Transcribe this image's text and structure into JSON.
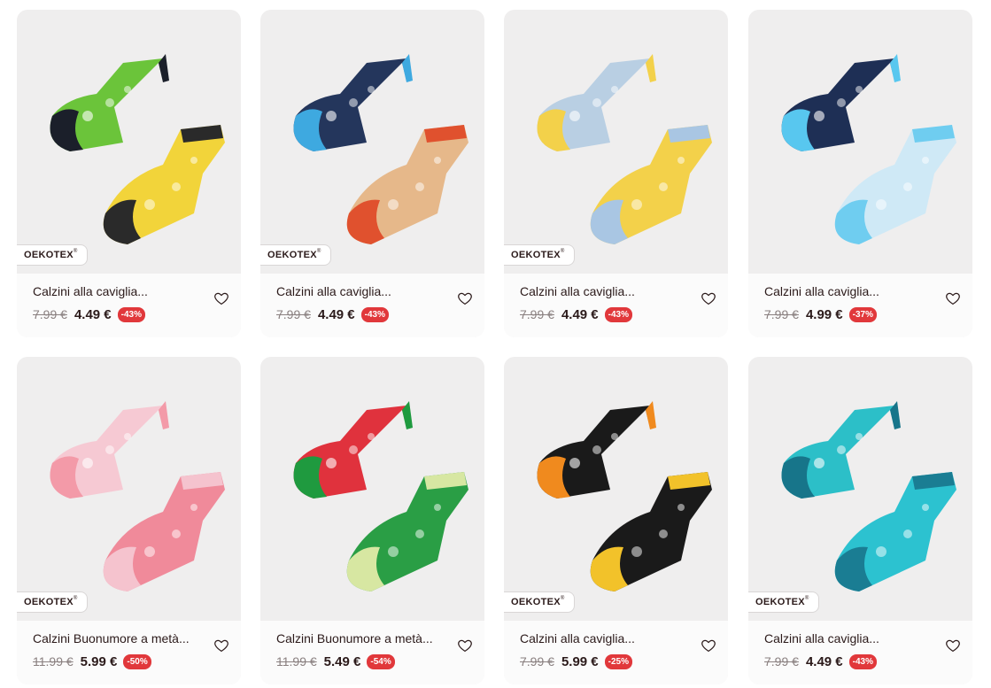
{
  "badge_label": "OEKOTEX",
  "badge_mark": "®",
  "products": [
    {
      "title": "Calzini alla caviglia...",
      "old_price": "7.99 €",
      "price": "4.49 €",
      "discount": "-43%",
      "badge": true,
      "icon": "bee-socks-image",
      "colors": [
        "#6bc43a",
        "#1b1f2a",
        "#f2d43a",
        "#2a2a2a"
      ]
    },
    {
      "title": "Calzini alla caviglia...",
      "old_price": "7.99 €",
      "price": "4.49 €",
      "discount": "-43%",
      "badge": true,
      "icon": "sailboat-socks-image",
      "colors": [
        "#24365c",
        "#3ea9e0",
        "#e6b88a",
        "#e0512e"
      ]
    },
    {
      "title": "Calzini alla caviglia...",
      "old_price": "7.99 €",
      "price": "4.49 €",
      "discount": "-43%",
      "badge": true,
      "icon": "lotus-socks-image",
      "colors": [
        "#b9cfe3",
        "#f3d14a",
        "#f3d14a",
        "#a9c6e3"
      ]
    },
    {
      "title": "Calzini alla caviglia...",
      "old_price": "7.99 €",
      "price": "4.99 €",
      "discount": "-37%",
      "badge": false,
      "icon": "ocean-socks-image",
      "colors": [
        "#1e2f55",
        "#58c7ef",
        "#cfe9f6",
        "#6fcdf0"
      ]
    },
    {
      "title": "Calzini Buonumore a metà...",
      "old_price": "11.99 €",
      "price": "5.99 €",
      "discount": "-50%",
      "badge": true,
      "icon": "strawberry-socks-image",
      "colors": [
        "#f6c9d3",
        "#f39aa8",
        "#f08a9a",
        "#f5c3ce"
      ]
    },
    {
      "title": "Calzini Buonumore a metà...",
      "old_price": "11.99 €",
      "price": "5.49 €",
      "discount": "-54%",
      "badge": false,
      "icon": "watermelon-socks-image",
      "colors": [
        "#e0323d",
        "#1f9a3f",
        "#2a9e45",
        "#d7e7a2"
      ]
    },
    {
      "title": "Calzini alla caviglia...",
      "old_price": "7.99 €",
      "price": "5.99 €",
      "discount": "-25%",
      "badge": true,
      "icon": "flower-black-socks-image",
      "colors": [
        "#1a1a1a",
        "#f08a1e",
        "#1a1a1a",
        "#f2c22a"
      ]
    },
    {
      "title": "Calzini alla caviglia...",
      "old_price": "7.99 €",
      "price": "4.49 €",
      "discount": "-43%",
      "badge": true,
      "icon": "daisy-socks-image",
      "colors": [
        "#2cbfc8",
        "#17758a",
        "#2cc2d0",
        "#1a7d93"
      ]
    }
  ]
}
